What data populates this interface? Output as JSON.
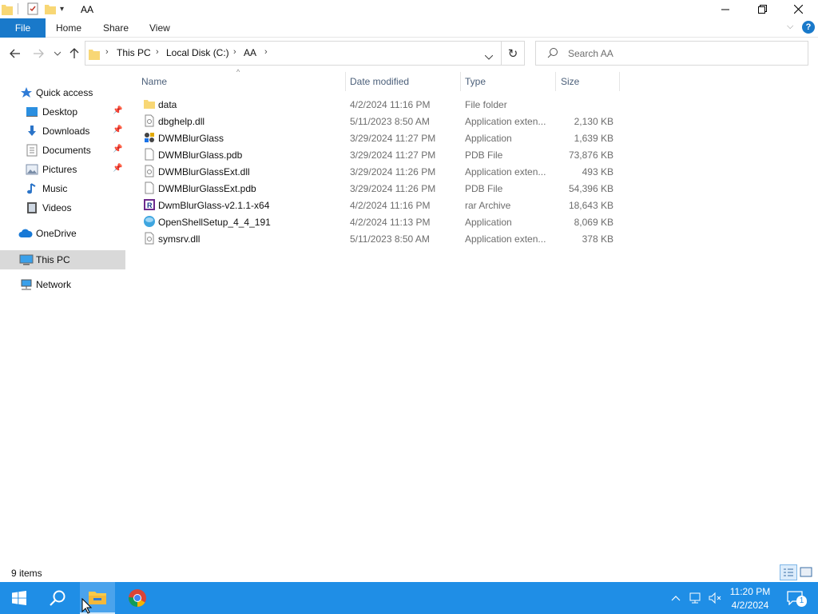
{
  "window": {
    "title": "AA"
  },
  "ribbon": {
    "tabs": [
      "File",
      "Home",
      "Share",
      "View"
    ]
  },
  "address": {
    "crumbs": [
      "This PC",
      "Local Disk (C:)",
      "AA"
    ]
  },
  "search": {
    "placeholder": "Search AA"
  },
  "nav": {
    "quick_access": "Quick access",
    "items": [
      "Desktop",
      "Downloads",
      "Documents",
      "Pictures",
      "Music",
      "Videos"
    ],
    "onedrive": "OneDrive",
    "this_pc": "This PC",
    "network": "Network"
  },
  "columns": {
    "name": "Name",
    "date": "Date modified",
    "type": "Type",
    "size": "Size"
  },
  "files": [
    {
      "name": "data",
      "date": "4/2/2024 11:16 PM",
      "type": "File folder",
      "size": "",
      "icon": "folder-icon"
    },
    {
      "name": "dbghelp.dll",
      "date": "5/11/2023 8:50 AM",
      "type": "Application exten...",
      "size": "2,130 KB",
      "icon": "dll-icon"
    },
    {
      "name": "DWMBlurGlass",
      "date": "3/29/2024 11:27 PM",
      "type": "Application",
      "size": "1,639 KB",
      "icon": "app-icon"
    },
    {
      "name": "DWMBlurGlass.pdb",
      "date": "3/29/2024 11:27 PM",
      "type": "PDB File",
      "size": "73,876 KB",
      "icon": "file-icon"
    },
    {
      "name": "DWMBlurGlassExt.dll",
      "date": "3/29/2024 11:26 PM",
      "type": "Application exten...",
      "size": "493 KB",
      "icon": "dll-icon"
    },
    {
      "name": "DWMBlurGlassExt.pdb",
      "date": "3/29/2024 11:26 PM",
      "type": "PDB File",
      "size": "54,396 KB",
      "icon": "file-icon"
    },
    {
      "name": "DwmBlurGlass-v2.1.1-x64",
      "date": "4/2/2024 11:16 PM",
      "type": "rar Archive",
      "size": "18,643 KB",
      "icon": "rar-icon"
    },
    {
      "name": "OpenShellSetup_4_4_191",
      "date": "4/2/2024 11:13 PM",
      "type": "Application",
      "size": "8,069 KB",
      "icon": "shell-icon"
    },
    {
      "name": "symsrv.dll",
      "date": "5/11/2023 8:50 AM",
      "type": "Application exten...",
      "size": "378 KB",
      "icon": "dll-icon"
    }
  ],
  "status": {
    "items": "9 items"
  },
  "taskbar": {
    "time": "11:20 PM",
    "date": "4/2/2024",
    "notifications": "1"
  },
  "colors": {
    "accent": "#1979ca",
    "taskbar": "#1f8ee6",
    "folder": "#f8d775",
    "selection": "#d9d9d9"
  }
}
